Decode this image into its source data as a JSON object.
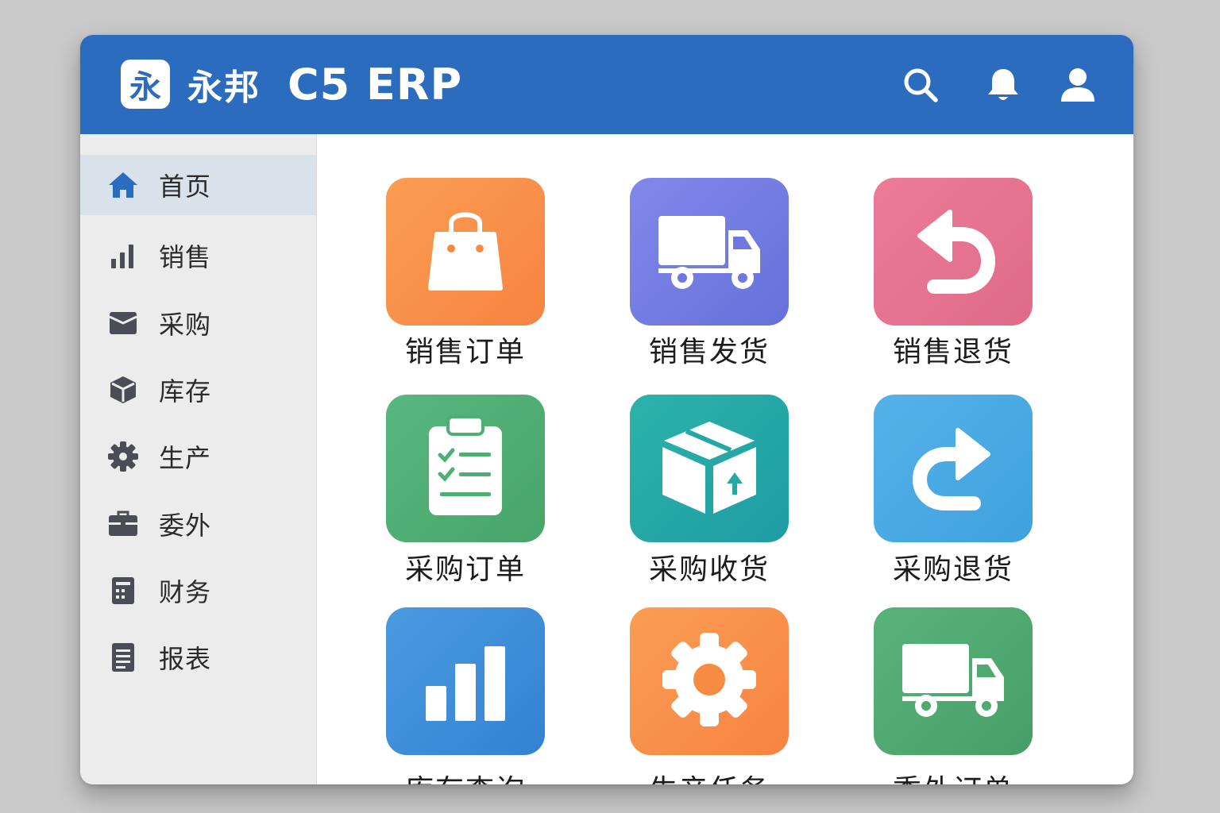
{
  "app": {
    "logo_char": "永",
    "name_cn": "永邦",
    "name_en": "C5 ERP"
  },
  "header_icons": [
    "search-icon",
    "bell-icon",
    "user-icon"
  ],
  "sidebar": {
    "items": [
      {
        "label": "首页",
        "icon": "home-icon",
        "active": true
      },
      {
        "label": "销售",
        "icon": "bar-chart-icon"
      },
      {
        "label": "采购",
        "icon": "box-icon"
      },
      {
        "label": "库存",
        "icon": "cube-icon"
      },
      {
        "label": "生产",
        "icon": "gear-icon"
      },
      {
        "label": "委外",
        "icon": "briefcase-icon"
      },
      {
        "label": "财务",
        "icon": "calculator-icon"
      },
      {
        "label": "报表",
        "icon": "document-icon"
      }
    ]
  },
  "tiles": [
    {
      "label": "销售订单",
      "icon": "shopping-bag-icon",
      "color": "#f88b42"
    },
    {
      "label": "销售发货",
      "icon": "truck-icon",
      "color": "#7079e0"
    },
    {
      "label": "销售退货",
      "icon": "return-arrow-icon",
      "color": "#e56f8f"
    },
    {
      "label": "采购订单",
      "icon": "clipboard-checklist-icon",
      "color": "#4fae74"
    },
    {
      "label": "采购收货",
      "icon": "package-icon",
      "color": "#22a8a6"
    },
    {
      "label": "采购退货",
      "icon": "redo-arrow-icon",
      "color": "#48a8e3"
    },
    {
      "label": "库存查询",
      "icon": "bar-chart-icon",
      "color": "#3d8cd9"
    },
    {
      "label": "生产任务",
      "icon": "gear-icon",
      "color": "#f88b42"
    },
    {
      "label": "委外订单",
      "icon": "truck-icon",
      "color": "#4faa70"
    }
  ]
}
